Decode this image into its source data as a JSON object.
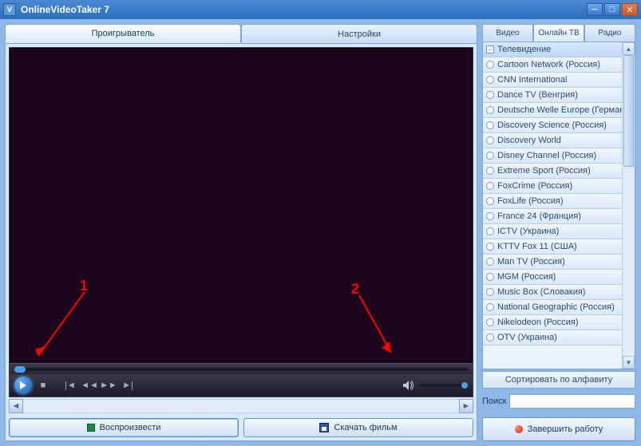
{
  "window": {
    "title": "OnlineVideoTaker 7"
  },
  "main_tabs": {
    "player": "Проигрыватель",
    "settings": "Настройки"
  },
  "annotations": {
    "one": "1",
    "two": "2"
  },
  "buttons": {
    "play": "Воспроизвести",
    "download": "Скачать фильм"
  },
  "right_tabs": {
    "video": "Видео",
    "online_tv": "Онлайн ТВ",
    "radio": "Радио"
  },
  "channel_header": "Телевидение",
  "channels": [
    "Cartoon Network (Россия)",
    "CNN International",
    "Dance TV (Венгрия)",
    "Deutsche Welle Europe (Герман",
    "Discovery Science (Россия)",
    "Discovery World",
    "Disney Channel (Россия)",
    "Extreme Sport (Россия)",
    "FoxCrime (Россия)",
    "FoxLife (Россия)",
    "France 24 (Франция)",
    "ICTV (Украина)",
    "KTTV Fox 11 (США)",
    "Man TV (Россия)",
    "MGM (Россия)",
    "Music Box (Словакия)",
    "National Geographic (Россия)",
    "Nikelodeon (Россия)",
    "OTV (Украина)"
  ],
  "sort": "Сортировать по алфавиту",
  "search": {
    "label": "Поиск",
    "value": ""
  },
  "quit": "Завершить работу"
}
